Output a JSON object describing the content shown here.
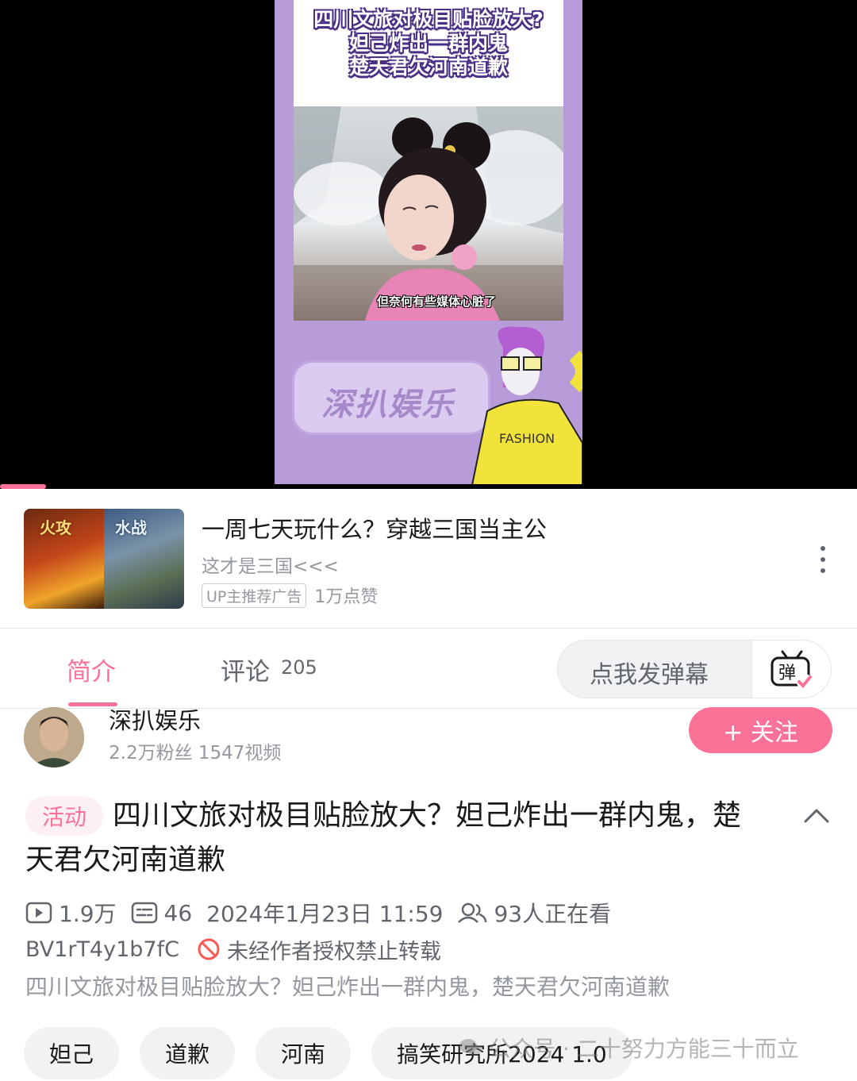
{
  "player": {
    "title_lines": [
      "四川文旅对极目贴脸放大?",
      "妲己炸出一群内鬼",
      "楚天君欠河南道歉"
    ],
    "subtitle": "但奈何有些媒体心脏了",
    "brand_logo": "深扒娱乐",
    "progress_fraction": 0.054
  },
  "ad": {
    "title": "一周七天玩什么？穿越三国当主公",
    "subtitle": "这才是三国<<<",
    "badge": "UP主推荐广告",
    "likes": "1万点赞",
    "thumb_left_tag": "火攻",
    "thumb_right_tag": "水战",
    "more_icon": "more-vertical-icon"
  },
  "tabs": {
    "intro": "简介",
    "comments": "评论",
    "comment_count": "205",
    "danmaku_placeholder": "点我发弹幕",
    "danmaku_icon": "danmaku-toggle-icon",
    "accent": "#fb7299"
  },
  "uploader": {
    "name": "深扒娱乐",
    "stats": "2.2万粉丝  1547视频",
    "follow_label": "+ 关注"
  },
  "video": {
    "activity_tag": "活动",
    "title": "四川文旅对极目贴脸放大？妲己炸出一群内鬼，楚天君欠河南道歉",
    "plays": "1.9万",
    "danmaku_count": "46",
    "datetime": "2024年1月23日 11:59",
    "watching": "93人正在看",
    "bvid": "BV1rT4y1b7fC",
    "repost_notice": "未经作者授权禁止转载",
    "description": "四川文旅对极目贴脸放大？妲己炸出一群内鬼，楚天君欠河南道歉"
  },
  "tags": [
    "妲己",
    "道歉",
    "河南",
    "搞笑研究所2024 1.0"
  ],
  "watermark": "公众号 · 二十努力方能三十而立"
}
